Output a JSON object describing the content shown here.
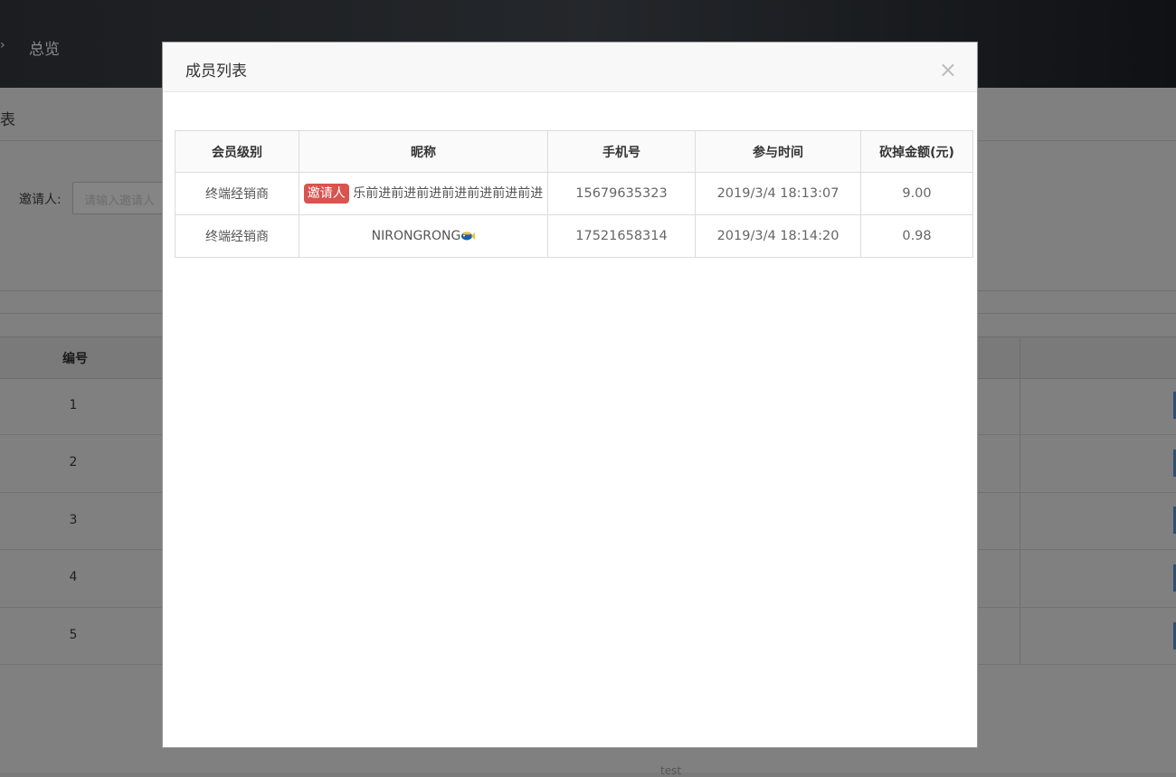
{
  "background": {
    "nav": {
      "overview": "总览",
      "arrow": "›"
    },
    "section_title": "表",
    "filter": {
      "label": "邀请人:",
      "placeholder": "请输入邀请人"
    },
    "table": {
      "col_id": "编号",
      "rows": [
        "1",
        "2",
        "3",
        "4",
        "5"
      ]
    },
    "footer_text": "test"
  },
  "modal": {
    "title": "成员列表",
    "close_symbol": "×",
    "columns": [
      "会员级别",
      "昵称",
      "手机号",
      "参与时间",
      "砍掉金额(元)"
    ],
    "rows": [
      {
        "level": "终端经销商",
        "badge": "邀请人",
        "nickname": "乐前进前进前进前进前进前进前进",
        "phone": "15679635323",
        "time": "2019/3/4 18:13:07",
        "amount": "9.00"
      },
      {
        "level": "终端经销商",
        "badge": "",
        "nickname": "NIRONGRONG",
        "nickname_icon": "fish-emoji-icon",
        "phone": "17521658314",
        "time": "2019/3/4 18:14:20",
        "amount": "0.98"
      }
    ]
  },
  "colors": {
    "badge": "#d9534f",
    "modal_header": "#f8f8f8",
    "topbar": "#1b1d20",
    "overlay": "#808080"
  }
}
